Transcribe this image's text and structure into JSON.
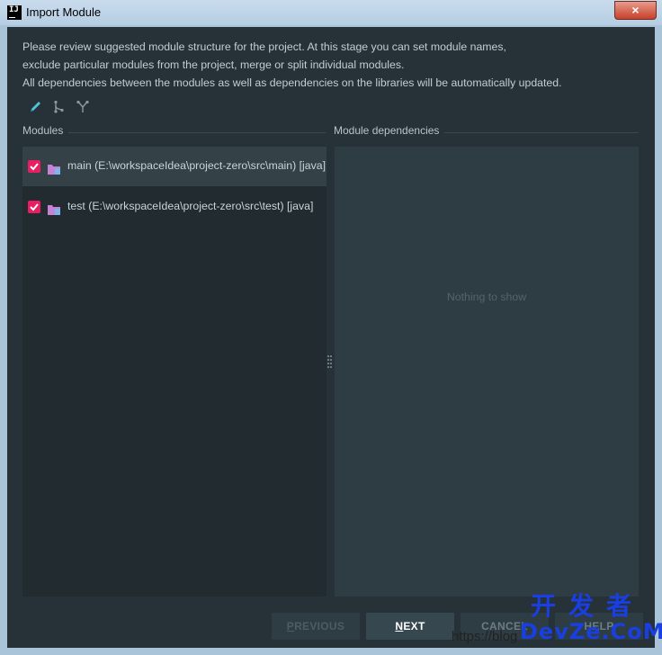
{
  "window": {
    "title": "Import Module",
    "app_icon": "intellij-icon",
    "app_icon_text": "IJ",
    "close_label": "×"
  },
  "description": {
    "line1": "Please review suggested module structure for the project. At this stage you can set module names,",
    "line2": "exclude particular modules from the project, merge or split individual modules.",
    "line3": "All dependencies between the modules as well as dependencies on the libraries will be automatically updated."
  },
  "toolbar": {
    "icons": [
      "pencil-icon",
      "split-icon",
      "merge-icon"
    ]
  },
  "modules": {
    "label": "Modules",
    "items": [
      {
        "checked": true,
        "text": "main (E:\\workspaceIdea\\project-zero\\src\\main) [java]",
        "selected": true
      },
      {
        "checked": true,
        "text": "test (E:\\workspaceIdea\\project-zero\\src\\test) [java]",
        "selected": false
      }
    ]
  },
  "dependencies": {
    "label": "Module dependencies",
    "empty_text": "Nothing to show"
  },
  "buttons": {
    "previous": {
      "mnemonic": "P",
      "rest": "REVIOUS"
    },
    "next": {
      "mnemonic": "N",
      "rest": "EXT"
    },
    "cancel": "CANCEL",
    "help": "HELP"
  },
  "watermark": {
    "url": "https://blog",
    "logo_cn": "开发者",
    "logo_en": "DevZe.CoM"
  },
  "colors": {
    "accent_checkbox": "#e81e63",
    "content_bg": "#263238",
    "folder": "#c683d6"
  }
}
